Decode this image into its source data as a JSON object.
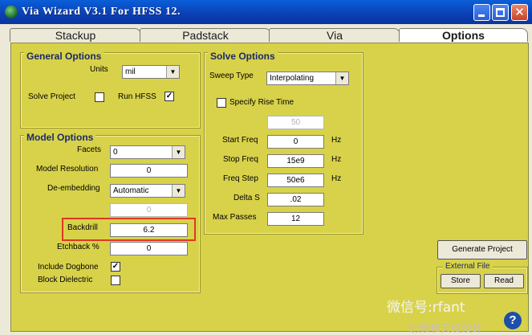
{
  "window": {
    "title": "Via Wizard V3.1 For HFSS 12.",
    "close_glyph": "✕"
  },
  "tabs": [
    "Stackup",
    "Padstack",
    "Via",
    "Options"
  ],
  "general": {
    "title": "General Options",
    "units_label": "Units",
    "units_value": "mil",
    "solve_project_label": "Solve Project",
    "solve_project_checked": "",
    "run_hfss_label": "Run HFSS",
    "run_hfss_checked": "✓"
  },
  "model": {
    "title": "Model Options",
    "facets_label": "Facets",
    "facets_value": "0",
    "resolution_label": "Model Resolution",
    "resolution_value": "0",
    "deembed_label": "De-embedding",
    "deembed_value": "Automatic",
    "deembed_extra_value": "0",
    "backdrill_label": "Backdrill",
    "backdrill_value": "6.2",
    "etchback_label": "Etchback %",
    "etchback_value": "0",
    "dogbone_label": "Include Dogbone",
    "dogbone_checked": "✓",
    "block_label": "Block Dielectric",
    "block_checked": ""
  },
  "solve": {
    "title": "Solve Options",
    "sweep_label": "Sweep Type",
    "sweep_value": "Interpolating",
    "rise_label": "Specify Rise Time",
    "rise_value": "50",
    "start_label": "Start Freq",
    "start_value": "0",
    "start_unit": "Hz",
    "stop_label": "Stop Freq",
    "stop_value": "15e9",
    "stop_unit": "Hz",
    "step_label": "Freq Step",
    "step_value": "50e6",
    "step_unit": "Hz",
    "delta_label": "Delta S",
    "delta_value": ".02",
    "passes_label": "Max Passes",
    "passes_value": "12"
  },
  "actions": {
    "generate": "Generate Project",
    "file_title": "External File",
    "store": "Store",
    "read": "Read"
  },
  "watermark": {
    "line1": "微信号:rfant",
    "line2": "射频和天线设计"
  },
  "help_glyph": "?"
}
